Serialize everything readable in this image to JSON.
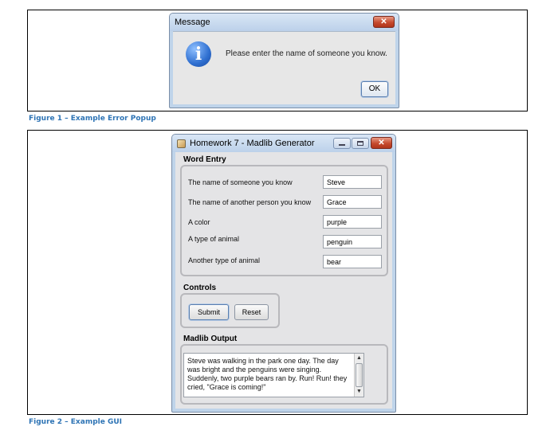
{
  "figure1": {
    "caption": "Figure 1 – Example Error Popup",
    "dialog": {
      "title": "Message",
      "close_label": "✕",
      "icon": "info-icon",
      "icon_glyph": "i",
      "message": "Please enter the name of someone you know.",
      "ok_label": "OK"
    }
  },
  "figure2": {
    "caption": "Figure 2 – Example GUI",
    "window": {
      "title": "Homework 7 - Madlib Generator",
      "close_label": "✕"
    },
    "word_entry": {
      "label": "Word Entry",
      "fields": [
        {
          "label": "The name of someone you know",
          "value": "Steve"
        },
        {
          "label": "The name of another person you know",
          "value": "Grace"
        },
        {
          "label": "A color",
          "value": "purple"
        },
        {
          "label": "A type of animal",
          "value": "penguin"
        },
        {
          "label": "Another type of animal",
          "value": "bear"
        }
      ]
    },
    "controls": {
      "label": "Controls",
      "submit_label": "Submit",
      "reset_label": "Reset"
    },
    "output": {
      "label": "Madlib Output",
      "text": "Steve was walking in the park one day. The day was bright and the penguins were singing. Suddenly, two purple bears ran by. Run! Run! they cried, \"Grace is coming!\""
    },
    "colors": {
      "caption": "#2e74b5",
      "close_button": "#c64a2e",
      "window_frame": "#bfd4ea"
    }
  }
}
